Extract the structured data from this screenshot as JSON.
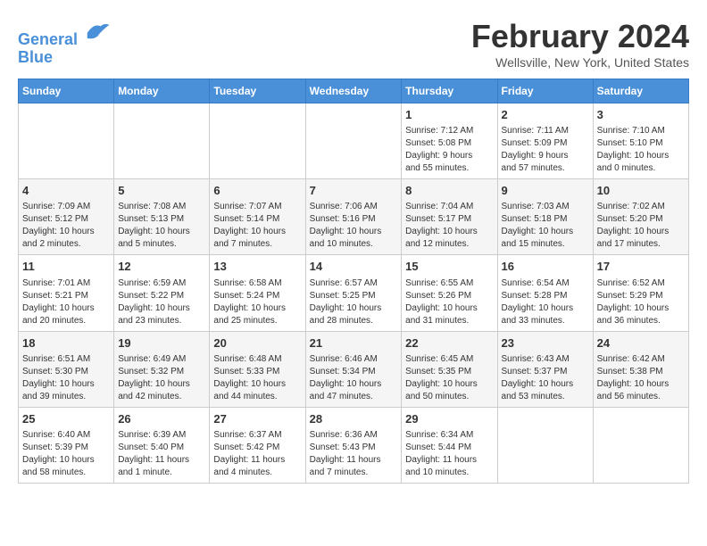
{
  "header": {
    "logo_line1": "General",
    "logo_line2": "Blue",
    "month": "February 2024",
    "location": "Wellsville, New York, United States"
  },
  "days_of_week": [
    "Sunday",
    "Monday",
    "Tuesday",
    "Wednesday",
    "Thursday",
    "Friday",
    "Saturday"
  ],
  "weeks": [
    [
      {
        "day": "",
        "info": ""
      },
      {
        "day": "",
        "info": ""
      },
      {
        "day": "",
        "info": ""
      },
      {
        "day": "",
        "info": ""
      },
      {
        "day": "1",
        "info": "Sunrise: 7:12 AM\nSunset: 5:08 PM\nDaylight: 9 hours\nand 55 minutes."
      },
      {
        "day": "2",
        "info": "Sunrise: 7:11 AM\nSunset: 5:09 PM\nDaylight: 9 hours\nand 57 minutes."
      },
      {
        "day": "3",
        "info": "Sunrise: 7:10 AM\nSunset: 5:10 PM\nDaylight: 10 hours\nand 0 minutes."
      }
    ],
    [
      {
        "day": "4",
        "info": "Sunrise: 7:09 AM\nSunset: 5:12 PM\nDaylight: 10 hours\nand 2 minutes."
      },
      {
        "day": "5",
        "info": "Sunrise: 7:08 AM\nSunset: 5:13 PM\nDaylight: 10 hours\nand 5 minutes."
      },
      {
        "day": "6",
        "info": "Sunrise: 7:07 AM\nSunset: 5:14 PM\nDaylight: 10 hours\nand 7 minutes."
      },
      {
        "day": "7",
        "info": "Sunrise: 7:06 AM\nSunset: 5:16 PM\nDaylight: 10 hours\nand 10 minutes."
      },
      {
        "day": "8",
        "info": "Sunrise: 7:04 AM\nSunset: 5:17 PM\nDaylight: 10 hours\nand 12 minutes."
      },
      {
        "day": "9",
        "info": "Sunrise: 7:03 AM\nSunset: 5:18 PM\nDaylight: 10 hours\nand 15 minutes."
      },
      {
        "day": "10",
        "info": "Sunrise: 7:02 AM\nSunset: 5:20 PM\nDaylight: 10 hours\nand 17 minutes."
      }
    ],
    [
      {
        "day": "11",
        "info": "Sunrise: 7:01 AM\nSunset: 5:21 PM\nDaylight: 10 hours\nand 20 minutes."
      },
      {
        "day": "12",
        "info": "Sunrise: 6:59 AM\nSunset: 5:22 PM\nDaylight: 10 hours\nand 23 minutes."
      },
      {
        "day": "13",
        "info": "Sunrise: 6:58 AM\nSunset: 5:24 PM\nDaylight: 10 hours\nand 25 minutes."
      },
      {
        "day": "14",
        "info": "Sunrise: 6:57 AM\nSunset: 5:25 PM\nDaylight: 10 hours\nand 28 minutes."
      },
      {
        "day": "15",
        "info": "Sunrise: 6:55 AM\nSunset: 5:26 PM\nDaylight: 10 hours\nand 31 minutes."
      },
      {
        "day": "16",
        "info": "Sunrise: 6:54 AM\nSunset: 5:28 PM\nDaylight: 10 hours\nand 33 minutes."
      },
      {
        "day": "17",
        "info": "Sunrise: 6:52 AM\nSunset: 5:29 PM\nDaylight: 10 hours\nand 36 minutes."
      }
    ],
    [
      {
        "day": "18",
        "info": "Sunrise: 6:51 AM\nSunset: 5:30 PM\nDaylight: 10 hours\nand 39 minutes."
      },
      {
        "day": "19",
        "info": "Sunrise: 6:49 AM\nSunset: 5:32 PM\nDaylight: 10 hours\nand 42 minutes."
      },
      {
        "day": "20",
        "info": "Sunrise: 6:48 AM\nSunset: 5:33 PM\nDaylight: 10 hours\nand 44 minutes."
      },
      {
        "day": "21",
        "info": "Sunrise: 6:46 AM\nSunset: 5:34 PM\nDaylight: 10 hours\nand 47 minutes."
      },
      {
        "day": "22",
        "info": "Sunrise: 6:45 AM\nSunset: 5:35 PM\nDaylight: 10 hours\nand 50 minutes."
      },
      {
        "day": "23",
        "info": "Sunrise: 6:43 AM\nSunset: 5:37 PM\nDaylight: 10 hours\nand 53 minutes."
      },
      {
        "day": "24",
        "info": "Sunrise: 6:42 AM\nSunset: 5:38 PM\nDaylight: 10 hours\nand 56 minutes."
      }
    ],
    [
      {
        "day": "25",
        "info": "Sunrise: 6:40 AM\nSunset: 5:39 PM\nDaylight: 10 hours\nand 58 minutes."
      },
      {
        "day": "26",
        "info": "Sunrise: 6:39 AM\nSunset: 5:40 PM\nDaylight: 11 hours\nand 1 minute."
      },
      {
        "day": "27",
        "info": "Sunrise: 6:37 AM\nSunset: 5:42 PM\nDaylight: 11 hours\nand 4 minutes."
      },
      {
        "day": "28",
        "info": "Sunrise: 6:36 AM\nSunset: 5:43 PM\nDaylight: 11 hours\nand 7 minutes."
      },
      {
        "day": "29",
        "info": "Sunrise: 6:34 AM\nSunset: 5:44 PM\nDaylight: 11 hours\nand 10 minutes."
      },
      {
        "day": "",
        "info": ""
      },
      {
        "day": "",
        "info": ""
      }
    ]
  ]
}
